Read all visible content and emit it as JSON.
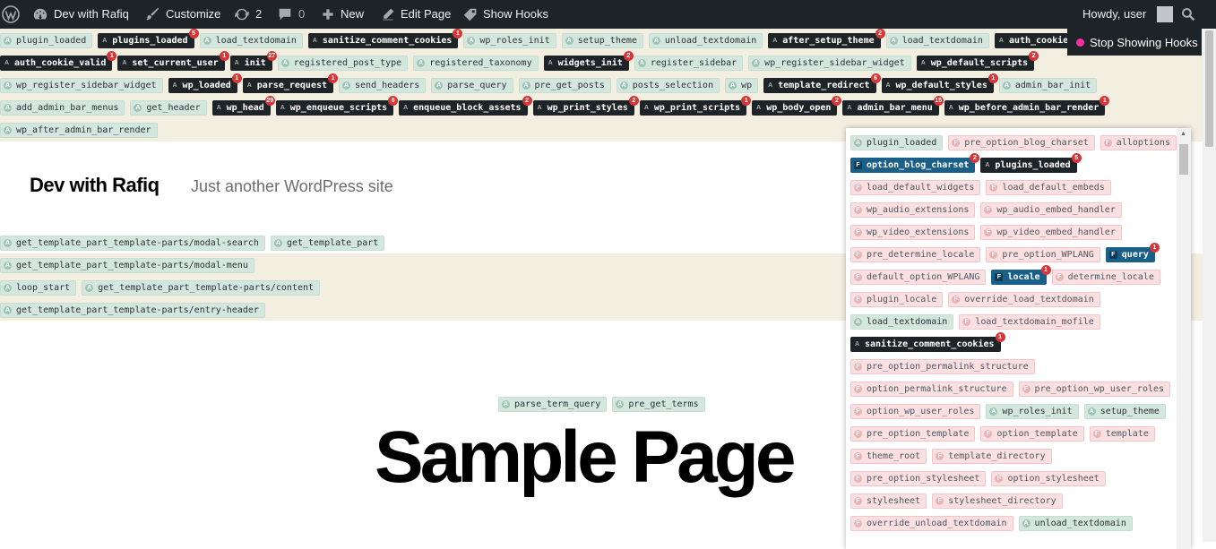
{
  "admin_bar": {
    "site_name": "Dev with Rafiq",
    "customize": "Customize",
    "updates_count": "2",
    "comments_count": "0",
    "new": "New",
    "edit_page": "Edit Page",
    "show_hooks": "Show Hooks",
    "howdy": "Howdy, user"
  },
  "stop_hooks": "Stop Showing Hooks",
  "top_hook_rows": [
    [
      {
        "name": "plugin_loaded",
        "type": "a"
      },
      {
        "name": "plugins_loaded",
        "type": "ad",
        "badge": "5"
      },
      {
        "name": "load_textdomain",
        "type": "a"
      },
      {
        "name": "sanitize_comment_cookies",
        "type": "ad",
        "badge": "1"
      },
      {
        "name": "wp_roles_init",
        "type": "a"
      },
      {
        "name": "setup_theme",
        "type": "a"
      },
      {
        "name": "unload_textdomain",
        "type": "a"
      },
      {
        "name": "after_setup_theme",
        "type": "ad",
        "badge": "2"
      },
      {
        "name": "load_textdomain",
        "type": "a"
      },
      {
        "name": "auth_cookie_",
        "type": "ad"
      }
    ],
    [
      {
        "name": "auth_cookie_valid",
        "type": "ad",
        "badge": "1"
      },
      {
        "name": "set_current_user",
        "type": "ad",
        "badge": "1"
      },
      {
        "name": "init",
        "type": "ad",
        "badge": "27"
      },
      {
        "name": "registered_post_type",
        "type": "a"
      },
      {
        "name": "registered_taxonomy",
        "type": "a"
      },
      {
        "name": "widgets_init",
        "type": "ad",
        "badge": "2"
      },
      {
        "name": "register_sidebar",
        "type": "a"
      },
      {
        "name": "wp_register_sidebar_widget",
        "type": "a"
      },
      {
        "name": "wp_default_scripts",
        "type": "ad",
        "badge": "2"
      }
    ],
    [
      {
        "name": "wp_register_sidebar_widget",
        "type": "a"
      },
      {
        "name": "wp_loaded",
        "type": "ad",
        "badge": "1"
      },
      {
        "name": "parse_request",
        "type": "ad",
        "badge": "1"
      },
      {
        "name": "send_headers",
        "type": "a"
      },
      {
        "name": "parse_query",
        "type": "a"
      },
      {
        "name": "pre_get_posts",
        "type": "a"
      },
      {
        "name": "posts_selection",
        "type": "a"
      },
      {
        "name": "wp",
        "type": "a"
      },
      {
        "name": "template_redirect",
        "type": "ad",
        "badge": "6"
      },
      {
        "name": "wp_default_styles",
        "type": "ad",
        "badge": "1"
      },
      {
        "name": "admin_bar_init",
        "type": "a"
      }
    ],
    [
      {
        "name": "add_admin_bar_menus",
        "type": "a"
      },
      {
        "name": "get_header",
        "type": "a"
      },
      {
        "name": "wp_head",
        "type": "ad",
        "badge": "29"
      },
      {
        "name": "wp_enqueue_scripts",
        "type": "ad",
        "badge": "6"
      },
      {
        "name": "enqueue_block_assets",
        "type": "ad",
        "badge": "2"
      },
      {
        "name": "wp_print_styles",
        "type": "ad",
        "badge": "2"
      },
      {
        "name": "wp_print_scripts",
        "type": "ad",
        "badge": "1"
      },
      {
        "name": "wp_body_open",
        "type": "ad",
        "badge": "2"
      },
      {
        "name": "admin_bar_menu",
        "type": "ad",
        "badge": "15"
      },
      {
        "name": "wp_before_admin_bar_render",
        "type": "ad",
        "badge": "1"
      }
    ],
    [
      {
        "name": "wp_after_admin_bar_render",
        "type": "a"
      }
    ]
  ],
  "site": {
    "title": "Dev with Rafiq",
    "description": "Just another WordPress site"
  },
  "template_rows": [
    [
      {
        "name": "get_template_part_template-parts/modal-search",
        "type": "a"
      },
      {
        "name": "get_template_part",
        "type": "a"
      }
    ],
    [
      {
        "name": "get_template_part_template-parts/modal-menu",
        "type": "a"
      }
    ],
    [
      {
        "name": "loop_start",
        "type": "a"
      },
      {
        "name": "get_template_part_template-parts/content",
        "type": "a"
      }
    ],
    [
      {
        "name": "get_template_part_template-parts/entry-header",
        "type": "a"
      }
    ]
  ],
  "term_hooks": [
    {
      "name": "parse_term_query",
      "type": "a"
    },
    {
      "name": "pre_get_terms",
      "type": "a"
    }
  ],
  "page_title": "Sample Page",
  "popup_rows": [
    [
      {
        "name": "plugin_loaded",
        "type": "a"
      },
      {
        "name": "pre_option_blog_charset",
        "type": "f"
      },
      {
        "name": "alloptions",
        "type": "f"
      }
    ],
    [
      {
        "name": "option_blog_charset",
        "type": "fd",
        "badge": "2"
      },
      {
        "name": "plugins_loaded",
        "type": "ad",
        "badge": "5"
      }
    ],
    [
      {
        "name": "load_default_widgets",
        "type": "f"
      },
      {
        "name": "load_default_embeds",
        "type": "f"
      }
    ],
    [
      {
        "name": "wp_audio_extensions",
        "type": "f"
      },
      {
        "name": "wp_audio_embed_handler",
        "type": "f"
      }
    ],
    [
      {
        "name": "wp_video_extensions",
        "type": "f"
      },
      {
        "name": "wp_video_embed_handler",
        "type": "f"
      }
    ],
    [
      {
        "name": "pre_determine_locale",
        "type": "f"
      },
      {
        "name": "pre_option_WPLANG",
        "type": "f"
      },
      {
        "name": "query",
        "type": "fd",
        "badge": "1"
      }
    ],
    [
      {
        "name": "default_option_WPLANG",
        "type": "f"
      },
      {
        "name": "locale",
        "type": "fd",
        "badge": "1"
      },
      {
        "name": "determine_locale",
        "type": "f"
      }
    ],
    [
      {
        "name": "plugin_locale",
        "type": "f"
      },
      {
        "name": "override_load_textdomain",
        "type": "f"
      }
    ],
    [
      {
        "name": "load_textdomain",
        "type": "a"
      },
      {
        "name": "load_textdomain_mofile",
        "type": "f"
      }
    ],
    [
      {
        "name": "sanitize_comment_cookies",
        "type": "ad",
        "badge": "1"
      }
    ],
    [
      {
        "name": "pre_option_permalink_structure",
        "type": "f"
      }
    ],
    [
      {
        "name": "option_permalink_structure",
        "type": "f"
      },
      {
        "name": "pre_option_wp_user_roles",
        "type": "f"
      }
    ],
    [
      {
        "name": "option_wp_user_roles",
        "type": "f"
      },
      {
        "name": "wp_roles_init",
        "type": "a"
      },
      {
        "name": "setup_theme",
        "type": "a"
      }
    ],
    [
      {
        "name": "pre_option_template",
        "type": "f"
      },
      {
        "name": "option_template",
        "type": "f"
      },
      {
        "name": "template",
        "type": "f"
      }
    ],
    [
      {
        "name": "theme_root",
        "type": "f"
      },
      {
        "name": "template_directory",
        "type": "f"
      }
    ],
    [
      {
        "name": "pre_option_stylesheet",
        "type": "f"
      },
      {
        "name": "option_stylesheet",
        "type": "f"
      }
    ],
    [
      {
        "name": "stylesheet",
        "type": "f"
      },
      {
        "name": "stylesheet_directory",
        "type": "f"
      }
    ],
    [
      {
        "name": "override_unload_textdomain",
        "type": "f"
      },
      {
        "name": "unload_textdomain",
        "type": "a"
      }
    ]
  ]
}
